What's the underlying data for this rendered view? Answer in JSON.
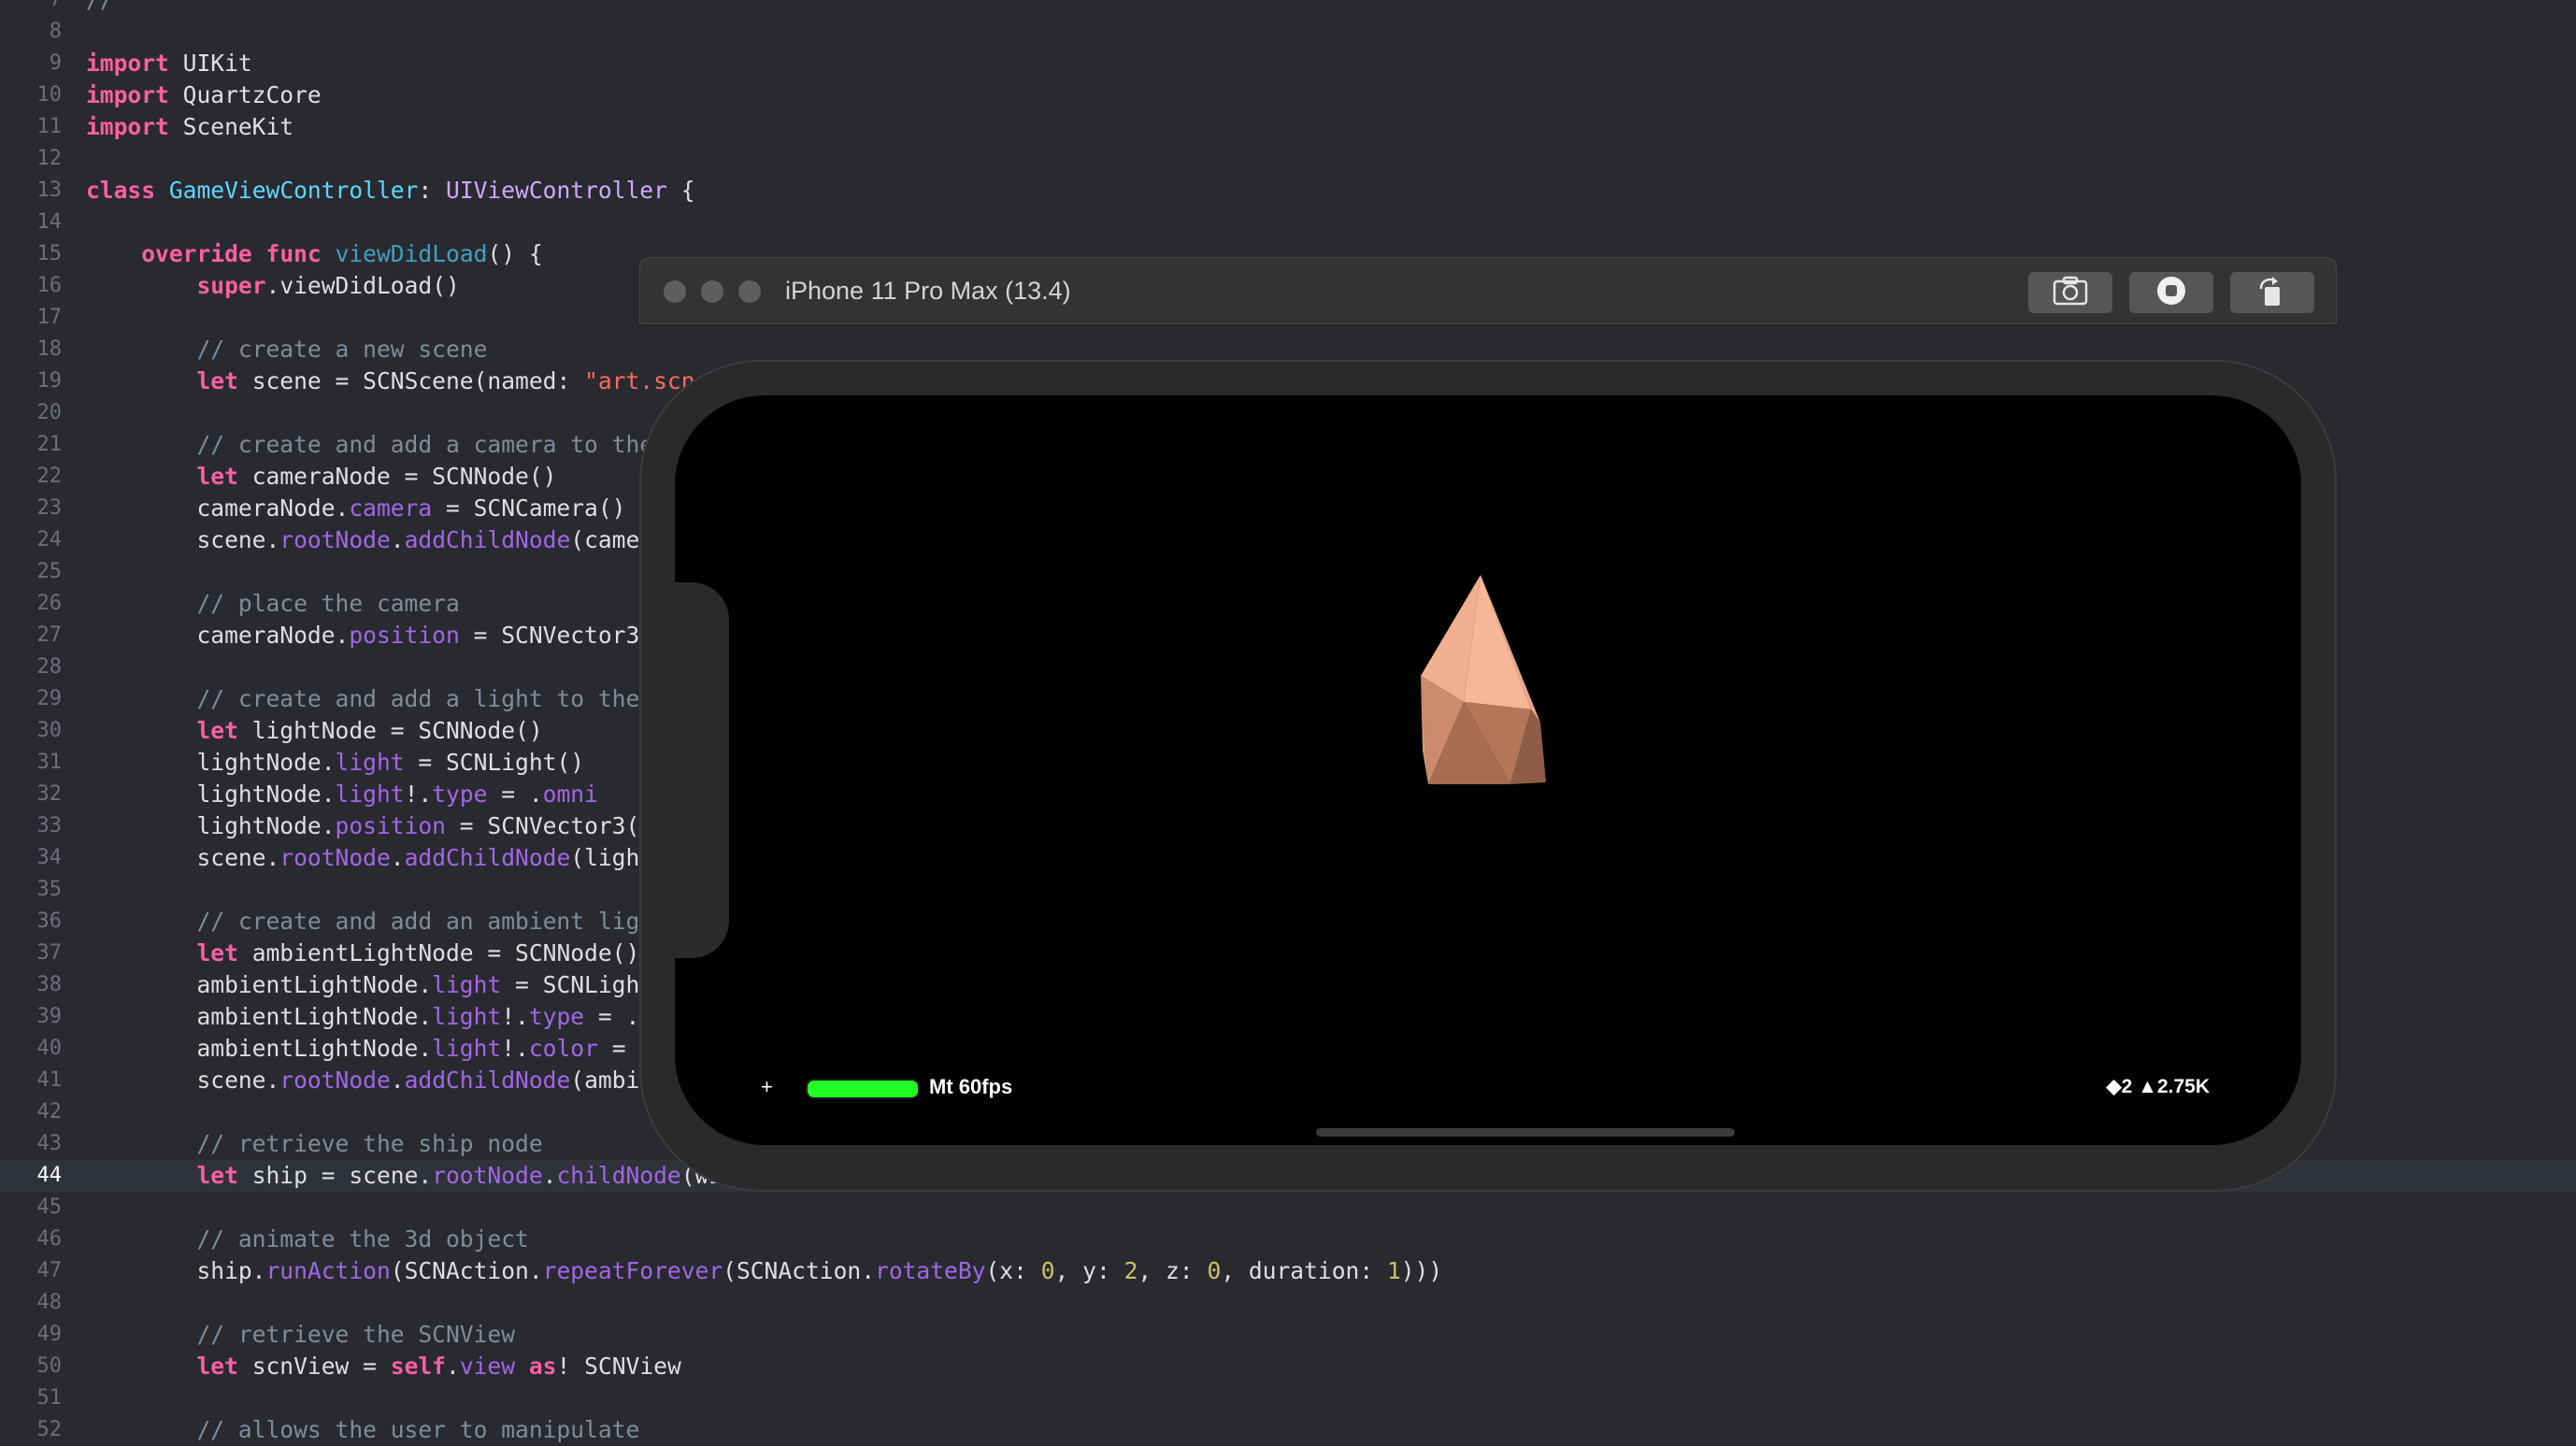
{
  "editor": {
    "current_line": 44,
    "lines": [
      {
        "n": "7",
        "tokens": [
          {
            "t": "//",
            "c": "cm"
          }
        ]
      },
      {
        "n": "8",
        "tokens": []
      },
      {
        "n": "9",
        "tokens": [
          {
            "t": "import",
            "c": "kw"
          },
          {
            "t": " UIKit",
            "c": "plain"
          }
        ]
      },
      {
        "n": "10",
        "tokens": [
          {
            "t": "import",
            "c": "kw"
          },
          {
            "t": " QuartzCore",
            "c": "plain"
          }
        ]
      },
      {
        "n": "11",
        "tokens": [
          {
            "t": "import",
            "c": "kw"
          },
          {
            "t": " SceneKit",
            "c": "plain"
          }
        ]
      },
      {
        "n": "12",
        "tokens": []
      },
      {
        "n": "13",
        "tokens": [
          {
            "t": "class",
            "c": "kw"
          },
          {
            "t": " ",
            "c": "plain"
          },
          {
            "t": "GameViewController",
            "c": "tdecl"
          },
          {
            "t": ": ",
            "c": "plain"
          },
          {
            "t": "UIViewController",
            "c": "type"
          },
          {
            "t": " {",
            "c": "plain"
          }
        ]
      },
      {
        "n": "14",
        "tokens": []
      },
      {
        "n": "15",
        "tokens": [
          {
            "t": "    ",
            "c": "plain"
          },
          {
            "t": "override",
            "c": "kw"
          },
          {
            "t": " ",
            "c": "plain"
          },
          {
            "t": "func",
            "c": "kw"
          },
          {
            "t": " ",
            "c": "plain"
          },
          {
            "t": "viewDidLoad",
            "c": "fdecl"
          },
          {
            "t": "() {",
            "c": "plain"
          }
        ]
      },
      {
        "n": "16",
        "tokens": [
          {
            "t": "        ",
            "c": "plain"
          },
          {
            "t": "super",
            "c": "kw"
          },
          {
            "t": ".viewDidLoad()",
            "c": "plain"
          }
        ]
      },
      {
        "n": "17",
        "tokens": []
      },
      {
        "n": "18",
        "tokens": [
          {
            "t": "        // create a new scene",
            "c": "cm"
          }
        ]
      },
      {
        "n": "19",
        "tokens": [
          {
            "t": "        ",
            "c": "plain"
          },
          {
            "t": "let",
            "c": "kw"
          },
          {
            "t": " scene = SCNScene(named: ",
            "c": "plain"
          },
          {
            "t": "\"art.scn",
            "c": "str"
          }
        ]
      },
      {
        "n": "20",
        "tokens": []
      },
      {
        "n": "21",
        "tokens": [
          {
            "t": "        // create and add a camera to the",
            "c": "cm"
          }
        ]
      },
      {
        "n": "22",
        "tokens": [
          {
            "t": "        ",
            "c": "plain"
          },
          {
            "t": "let",
            "c": "kw"
          },
          {
            "t": " cameraNode = SCNNode()",
            "c": "plain"
          }
        ]
      },
      {
        "n": "23",
        "tokens": [
          {
            "t": "        cameraNode.",
            "c": "plain"
          },
          {
            "t": "camera",
            "c": "prop"
          },
          {
            "t": " = SCNCamera()",
            "c": "plain"
          }
        ]
      },
      {
        "n": "24",
        "tokens": [
          {
            "t": "        scene.",
            "c": "plain"
          },
          {
            "t": "rootNode",
            "c": "prop"
          },
          {
            "t": ".",
            "c": "plain"
          },
          {
            "t": "addChildNode",
            "c": "mth"
          },
          {
            "t": "(camer",
            "c": "plain"
          }
        ]
      },
      {
        "n": "25",
        "tokens": []
      },
      {
        "n": "26",
        "tokens": [
          {
            "t": "        // place the camera",
            "c": "cm"
          }
        ]
      },
      {
        "n": "27",
        "tokens": [
          {
            "t": "        cameraNode.",
            "c": "plain"
          },
          {
            "t": "position",
            "c": "prop"
          },
          {
            "t": " = SCNVector3(",
            "c": "plain"
          }
        ]
      },
      {
        "n": "28",
        "tokens": []
      },
      {
        "n": "29",
        "tokens": [
          {
            "t": "        // create and add a light to the",
            "c": "cm"
          }
        ]
      },
      {
        "n": "30",
        "tokens": [
          {
            "t": "        ",
            "c": "plain"
          },
          {
            "t": "let",
            "c": "kw"
          },
          {
            "t": " lightNode = SCNNode()",
            "c": "plain"
          }
        ]
      },
      {
        "n": "31",
        "tokens": [
          {
            "t": "        lightNode.",
            "c": "plain"
          },
          {
            "t": "light",
            "c": "prop"
          },
          {
            "t": " = SCNLight()",
            "c": "plain"
          }
        ]
      },
      {
        "n": "32",
        "tokens": [
          {
            "t": "        lightNode.",
            "c": "plain"
          },
          {
            "t": "light",
            "c": "prop"
          },
          {
            "t": "!.",
            "c": "plain"
          },
          {
            "t": "type",
            "c": "prop"
          },
          {
            "t": " = .",
            "c": "plain"
          },
          {
            "t": "omni",
            "c": "prop"
          }
        ]
      },
      {
        "n": "33",
        "tokens": [
          {
            "t": "        lightNode.",
            "c": "plain"
          },
          {
            "t": "position",
            "c": "prop"
          },
          {
            "t": " = SCNVector3(",
            "c": "plain"
          }
        ]
      },
      {
        "n": "34",
        "tokens": [
          {
            "t": "        scene.",
            "c": "plain"
          },
          {
            "t": "rootNode",
            "c": "prop"
          },
          {
            "t": ".",
            "c": "plain"
          },
          {
            "t": "addChildNode",
            "c": "mth"
          },
          {
            "t": "(ligh",
            "c": "plain"
          }
        ]
      },
      {
        "n": "35",
        "tokens": []
      },
      {
        "n": "36",
        "tokens": [
          {
            "t": "        // create and add an ambient lig",
            "c": "cm"
          }
        ]
      },
      {
        "n": "37",
        "tokens": [
          {
            "t": "        ",
            "c": "plain"
          },
          {
            "t": "let",
            "c": "kw"
          },
          {
            "t": " ambientLightNode = SCNNode()",
            "c": "plain"
          }
        ]
      },
      {
        "n": "38",
        "tokens": [
          {
            "t": "        ambientLightNode.",
            "c": "plain"
          },
          {
            "t": "light",
            "c": "prop"
          },
          {
            "t": " = SCNLigh",
            "c": "plain"
          }
        ]
      },
      {
        "n": "39",
        "tokens": [
          {
            "t": "        ambientLightNode.",
            "c": "plain"
          },
          {
            "t": "light",
            "c": "prop"
          },
          {
            "t": "!.",
            "c": "plain"
          },
          {
            "t": "type",
            "c": "prop"
          },
          {
            "t": " = .",
            "c": "plain"
          }
        ]
      },
      {
        "n": "40",
        "tokens": [
          {
            "t": "        ambientLightNode.",
            "c": "plain"
          },
          {
            "t": "light",
            "c": "prop"
          },
          {
            "t": "!.",
            "c": "plain"
          },
          {
            "t": "color",
            "c": "prop"
          },
          {
            "t": " = ",
            "c": "plain"
          }
        ]
      },
      {
        "n": "41",
        "tokens": [
          {
            "t": "        scene.",
            "c": "plain"
          },
          {
            "t": "rootNode",
            "c": "prop"
          },
          {
            "t": ".",
            "c": "plain"
          },
          {
            "t": "addChildNode",
            "c": "mth"
          },
          {
            "t": "(ambi",
            "c": "plain"
          }
        ]
      },
      {
        "n": "42",
        "tokens": []
      },
      {
        "n": "43",
        "tokens": [
          {
            "t": "        // retrieve the ship node",
            "c": "cm"
          }
        ]
      },
      {
        "n": "44",
        "tokens": [
          {
            "t": "        ",
            "c": "plain"
          },
          {
            "t": "let",
            "c": "kw"
          },
          {
            "t": " ship = scene.",
            "c": "plain"
          },
          {
            "t": "rootNode",
            "c": "prop"
          },
          {
            "t": ".",
            "c": "plain"
          },
          {
            "t": "childNode",
            "c": "mth"
          },
          {
            "t": "(wi",
            "c": "plain"
          }
        ]
      },
      {
        "n": "45",
        "tokens": []
      },
      {
        "n": "46",
        "tokens": [
          {
            "t": "        // animate the 3d object",
            "c": "cm"
          }
        ]
      },
      {
        "n": "47",
        "tokens": [
          {
            "t": "        ship.",
            "c": "plain"
          },
          {
            "t": "runAction",
            "c": "mth"
          },
          {
            "t": "(SCNAction.",
            "c": "plain"
          },
          {
            "t": "repeatForever",
            "c": "mth"
          },
          {
            "t": "(SCNAction.",
            "c": "plain"
          },
          {
            "t": "rotateBy",
            "c": "mth"
          },
          {
            "t": "(x: ",
            "c": "plain"
          },
          {
            "t": "0",
            "c": "num"
          },
          {
            "t": ", y: ",
            "c": "plain"
          },
          {
            "t": "2",
            "c": "num"
          },
          {
            "t": ", z: ",
            "c": "plain"
          },
          {
            "t": "0",
            "c": "num"
          },
          {
            "t": ", duration: ",
            "c": "plain"
          },
          {
            "t": "1",
            "c": "num"
          },
          {
            "t": ")))",
            "c": "plain"
          }
        ]
      },
      {
        "n": "48",
        "tokens": []
      },
      {
        "n": "49",
        "tokens": [
          {
            "t": "        // retrieve the SCNView",
            "c": "cm"
          }
        ]
      },
      {
        "n": "50",
        "tokens": [
          {
            "t": "        ",
            "c": "plain"
          },
          {
            "t": "let",
            "c": "kw"
          },
          {
            "t": " scnView = ",
            "c": "plain"
          },
          {
            "t": "self",
            "c": "kw"
          },
          {
            "t": ".",
            "c": "plain"
          },
          {
            "t": "view",
            "c": "prop"
          },
          {
            "t": " ",
            "c": "plain"
          },
          {
            "t": "as",
            "c": "kw"
          },
          {
            "t": "! SCNView",
            "c": "plain"
          }
        ]
      },
      {
        "n": "51",
        "tokens": []
      },
      {
        "n": "52",
        "tokens": [
          {
            "t": "        // allows the user to manipulate",
            "c": "cm"
          }
        ]
      }
    ]
  },
  "simulator": {
    "title": "iPhone 11 Pro Max (13.4)",
    "buttons": [
      {
        "name": "screenshot-button",
        "icon": "camera-icon"
      },
      {
        "name": "home-button",
        "icon": "home-icon"
      },
      {
        "name": "rotate-button",
        "icon": "rotate-icon"
      }
    ],
    "stats": {
      "plus": "+",
      "fps_fill": 1.0,
      "fps_label": "Mt 60fps",
      "scene_stats": "◆2 ▲2.75K"
    },
    "colors": {
      "fps_bar": "#22ff22",
      "object": "#e8a583"
    }
  }
}
